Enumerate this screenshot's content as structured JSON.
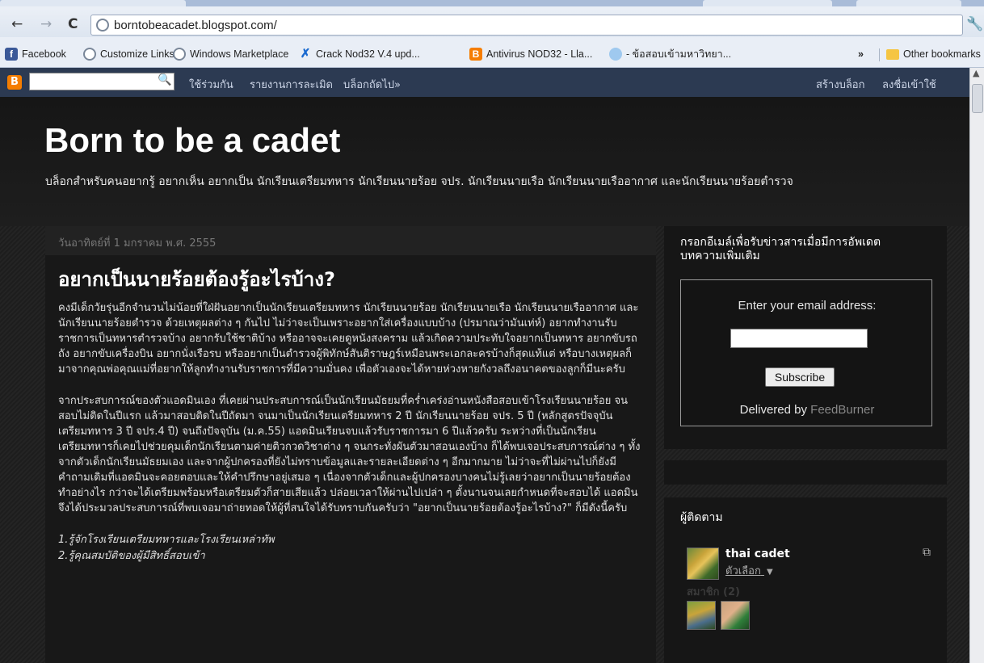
{
  "browser": {
    "url": "borntobeacadet.blogspot.com/",
    "nav_back": "←",
    "nav_forward": "→",
    "nav_reload": "C",
    "menu_icon": "wrench-icon",
    "bookmarks": [
      {
        "label": "Facebook",
        "icon": "facebook-icon"
      },
      {
        "label": "Customize Links",
        "icon": "globe-icon"
      },
      {
        "label": "Windows Marketplace",
        "icon": "globe-icon"
      },
      {
        "label": "Crack Nod32 V.4 upd...",
        "icon": "x-icon"
      },
      {
        "label": "Antivirus NOD32 - Lla...",
        "icon": "blogger-icon"
      },
      {
        "label": "- ข้อสอบเข้ามหาวิทยา...",
        "icon": "eye-icon"
      }
    ],
    "chevron": "»",
    "other_bookmarks": "Other bookmarks"
  },
  "navbar": {
    "logo": "B",
    "links": [
      "ใช้ร่วมกัน",
      "รายงานการละเมิด",
      "บล็อกถัดไป»"
    ],
    "right_links": [
      "สร้างบล็อก",
      "ลงชื่อเข้าใช้"
    ]
  },
  "blog": {
    "title": "Born to be a cadet",
    "description": "บล็อกสำหรับคนอยากรู้ อยากเห็น อยากเป็น นักเรียนเตรียมทหาร นักเรียนนายร้อย จปร. นักเรียนนายเรือ นักเรียนนายเรืออากาศ และนักเรียนนายร้อยตำรวจ"
  },
  "post": {
    "date": "วันอาทิตย์ที่ 1 มกราคม พ.ศ. 2555",
    "title": "อยากเป็นนายร้อยต้องรู้อะไรบ้าง?",
    "paragraph1": "คงมีเด็กวัยรุ่นอีกจำนวนไม่น้อยที่ใฝ่ฝันอยากเป็นนักเรียนเตรียมทหาร นักเรียนนายร้อย นักเรียนนายเรือ นักเรียนนายเรืออากาศ และนักเรียนนายร้อยตำรวจ ด้วยเหตุผลต่าง ๆ กันไป ไม่ว่าจะเป็นเพราะอยากใส่เครื่องแบบบ้าง (ปรมาณว่ามันเท่ห์) อยากทำงานรับราชการเป็นทหารตำรวจบ้าง อยากรับใช้ชาติบ้าง หรืออาจจะเคยดูหนังสงคราม แล้วเกิดความประทับใจอยากเป็นทหาร อยากขับรถถัง อยากขับเครื่องบิน อยากนั่งเรือรบ หรืออยากเป็นตำรวจผู้พิทักษ์สันติราษฎร์เหมือนพระเอกละครบ้างก็สุดแท้แต่ หรือบางเหตุผลก็มาจากคุณพ่อคุณแม่ที่อยากให้ลูกทำงานรับราชการที่มีความมั่นคง เพื่อตัวเองจะได้หายห่วงหายกังวลถึงอนาคตของลูกก็มีนะครับ",
    "paragraph2": "จากประสบการณ์ของตัวแอดมินเอง ที่เคยผ่านประสบการณ์เป็นนักเรียนมัธยมที่คร่ำเคร่งอ่านหนังสือสอบเข้าโรงเรียนนายร้อย จนสอบไม่ติดในปีแรก แล้วมาสอบติดในปีถัดมา จนมาเป็นนักเรียนเตรียมทหาร 2 ปี นักเรียนนายร้อย จปร. 5 ปี (หลักสูตรปัจจุบัน เตรียมทหาร 3 ปี จปร.4 ปี) จนถึงปัจจุบัน (ม.ค.55) แอดมินเรียนจบแล้วรับราชการมา 6 ปีแล้วครับ ระหว่างที่เป็นนักเรียนเตรียมทหารก็เคยไปช่วยคุมเด็กนักเรียนตามค่ายติวกวดวิชาต่าง ๆ จนกระทั่งผันตัวมาสอนเองบ้าง ก็ได้พบเจอประสบการณ์ต่าง ๆ ทั้งจากตัวเด็กนักเรียนมัธยมเอง และจากผู้ปกครองที่ยังไม่ทราบข้อมูลและรายละเอียดต่าง ๆ อีกมากมาย ไม่ว่าจะที่ไม่ผ่านไปก็ยังมีคำถามเดิมที่แอดมินจะคอยตอบและให้คำปรึกษาอยู่เสมอ ๆ เนื่องจากตัวเด็กและผู้ปกครองบางคนไม่รู้เลยว่าอยากเป็นนายร้อยต้องทำอย่างไร กว่าจะได้เตรียมพร้อมหรือเตรียมตัวก็สายเสียแล้ว ปล่อยเวลาให้ผ่านไปเปล่า ๆ ตั้งนานจนเลยกำหนดที่จะสอบได้ แอดมินจึงได้ประมวลประสบการณ์ที่พบเจอมาถ่ายทอดให้ผู้ที่สนใจได้รับทราบกันครับว่า \"อยากเป็นนายร้อยต้องรู้อะไรบ้าง?\" ก็มีดังนี้ครับ",
    "list": [
      "1.รู้จักโรงเรียนเตรียมทหารและโรงเรียนเหล่าทัพ",
      "2.รู้คุณสมบัติของผู้มีสิทธิ์สอบเข้า"
    ]
  },
  "sidebar": {
    "subscribe": {
      "title": "กรอกอีเมล์เพื่อรับข่าวสารเมื่อมีการอัพเดตบทความเพิ่มเติม",
      "label": "Enter your email address:",
      "button": "Subscribe",
      "delivered_by": "Delivered by",
      "provider": "FeedBurner"
    },
    "followers": {
      "title": "ผู้ติดตาม",
      "name": "thai cadet",
      "options": "ตัวเลือก",
      "members": "สมาชิก (2)"
    }
  }
}
